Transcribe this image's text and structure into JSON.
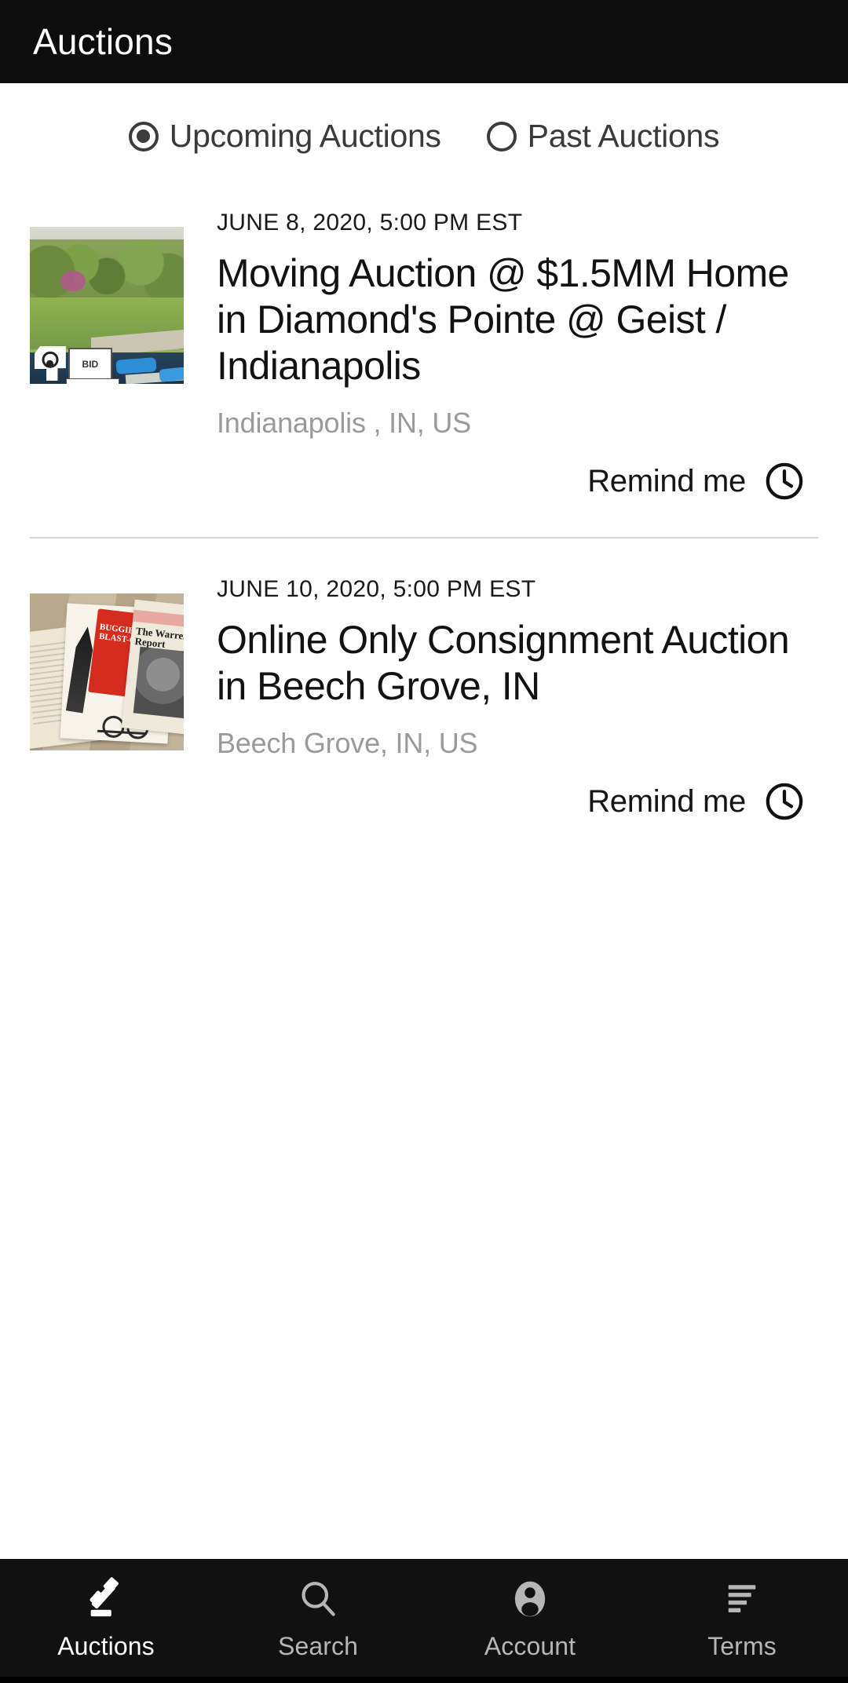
{
  "header": {
    "title": "Auctions"
  },
  "filter": {
    "options": [
      {
        "label": "Upcoming Auctions",
        "selected": true,
        "icon": "radio-selected-icon"
      },
      {
        "label": "Past Auctions",
        "selected": false,
        "icon": "radio-unselected-icon"
      }
    ]
  },
  "listings": [
    {
      "date": "JUNE 8, 2020, 5:00 PM EST",
      "title": "Moving Auction @ $1.5MM Home in Diamond's Pointe @ Geist / Indianapolis",
      "location": "Indianapolis , IN, US",
      "remind_label": "Remind me",
      "remind_icon": "clock-icon",
      "thumbnail": "lakefront-property-photo",
      "thumbnail_badges": [
        "indiana-state-badge",
        "online-bid-laptop-badge"
      ],
      "badge_text": "BID"
    },
    {
      "date": "JUNE 10, 2020, 5:00 PM EST",
      "title": "Online Only Consignment Auction in Beech Grove, IN",
      "location": "Beech Grove, IN, US",
      "remind_label": "Remind me",
      "remind_icon": "clock-icon",
      "thumbnail": "vintage-newspapers-photo",
      "thumbnail_text": [
        "BUGGIES to BLAST-OFF",
        "The Warren Report"
      ]
    }
  ],
  "bottom_nav": {
    "items": [
      {
        "label": "Auctions",
        "icon": "gavel-icon",
        "active": true
      },
      {
        "label": "Search",
        "icon": "search-icon",
        "active": false
      },
      {
        "label": "Account",
        "icon": "person-icon",
        "active": false
      },
      {
        "label": "Terms",
        "icon": "list-lines-icon",
        "active": false
      }
    ]
  },
  "colors": {
    "header_bg": "#0d0d0d",
    "nav_bg": "#111111",
    "page_bg": "#ffffff",
    "text_primary": "#121212",
    "text_muted": "#9a9a9a",
    "divider": "#d6d6d6",
    "nav_label": "#b6b6b6"
  }
}
